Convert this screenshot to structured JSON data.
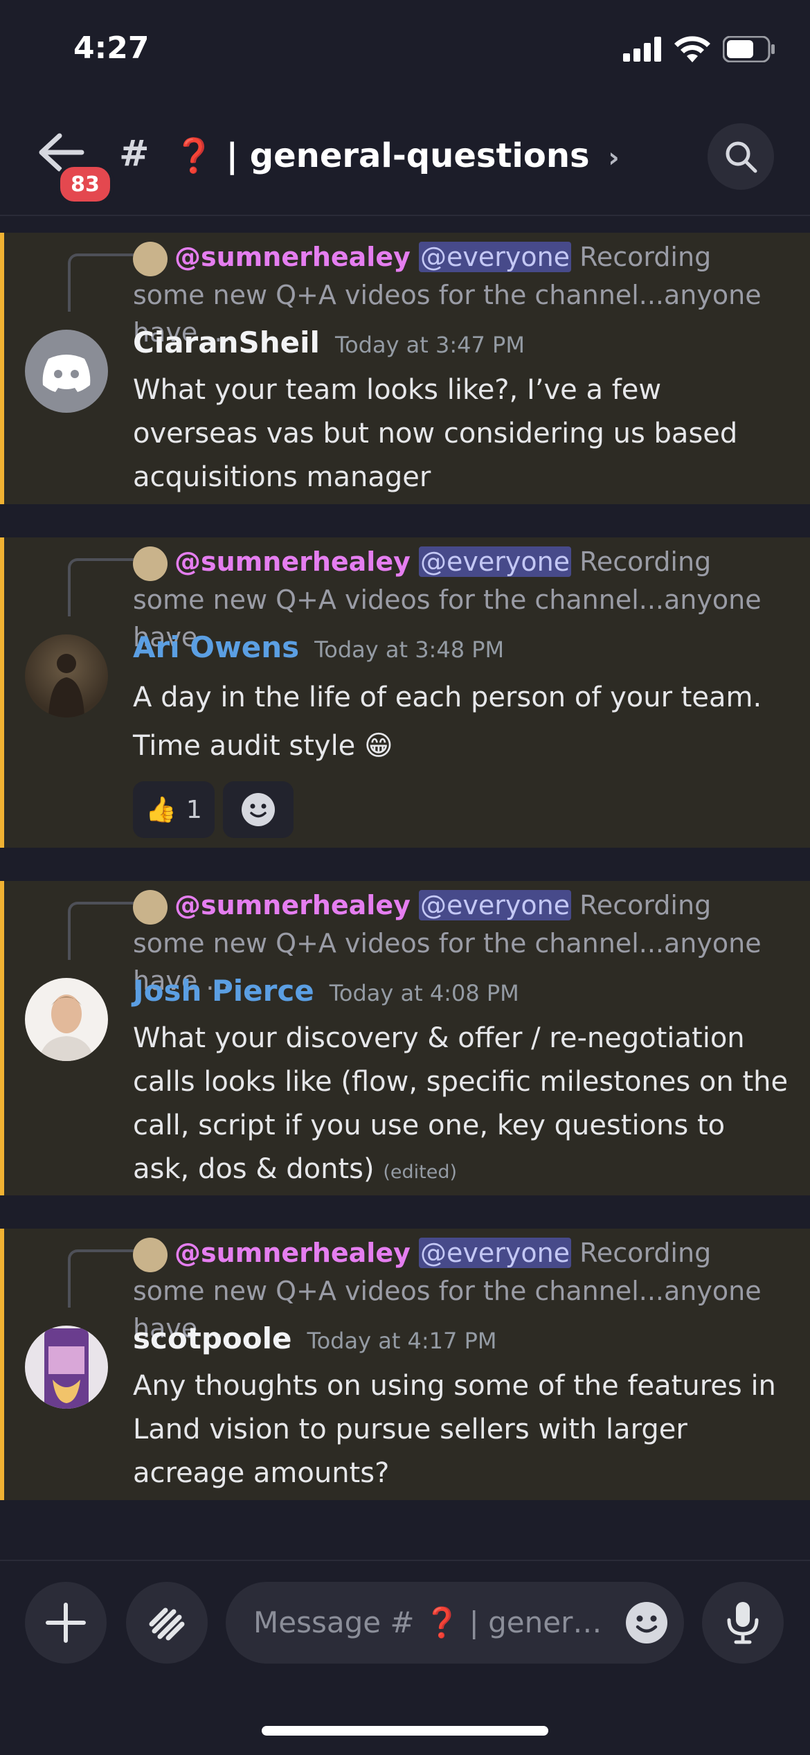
{
  "status_bar": {
    "time": "4:27"
  },
  "header": {
    "unread_badge": "83",
    "channel_prefix": "#",
    "channel_emoji": "❓",
    "channel_name": "| general-questions",
    "chevron": "›"
  },
  "messages": [
    {
      "reply": {
        "user": "@sumnerhealey",
        "mention": "@everyone",
        "text": "Recording some new Q+A videos for the channel...anyone have ..."
      },
      "author": "CiaranSheil",
      "author_color": "#f2f3f5",
      "timestamp": "Today at 3:47 PM",
      "body": "What your team looks like?, I’ve a few overseas vas but now considering us based acquisitions manager",
      "avatar": "discord-default-avatar"
    },
    {
      "reply": {
        "user": "@sumnerhealey",
        "mention": "@everyone",
        "text": "Recording some new Q+A videos for the channel...anyone have ..."
      },
      "author": "Ari Owens",
      "author_color": "#5b9fe3",
      "timestamp": "Today at 3:48 PM",
      "body": "A day in the life of each person of your team. Time audit style 😁",
      "reactions": [
        {
          "emoji": "👍",
          "count": "1"
        }
      ],
      "avatar": "photo-avatar"
    },
    {
      "reply": {
        "user": "@sumnerhealey",
        "mention": "@everyone",
        "text": "Recording some new Q+A videos for the channel...anyone have ..."
      },
      "author": "Josh Pierce",
      "author_color": "#5b9fe3",
      "timestamp": "Today at 4:08 PM",
      "body": "What your discovery & offer / re-negotiation calls looks like (flow, specific milestones on the call, script if you use one, key questions to ask, dos & donts)",
      "edited": "(edited)",
      "avatar": "photo-avatar"
    },
    {
      "reply": {
        "user": "@sumnerhealey",
        "mention": "@everyone",
        "text": "Recording some new Q+A videos for the channel...anyone have ..."
      },
      "author": "scotpoole",
      "author_color": "#f2f3f5",
      "timestamp": "Today at 4:17 PM",
      "body": "Any thoughts on using some of the features in Land vision to pursue sellers with larger acreage amounts?",
      "avatar": "hazy-ipa-avatar"
    }
  ],
  "composer": {
    "placeholder": "Message # ❓ | general..."
  },
  "colors": {
    "accent_bar": "#f0b232",
    "mention_bg": "#474a8a",
    "reply_user": "#e57ef0",
    "badge": "#e4484f"
  }
}
